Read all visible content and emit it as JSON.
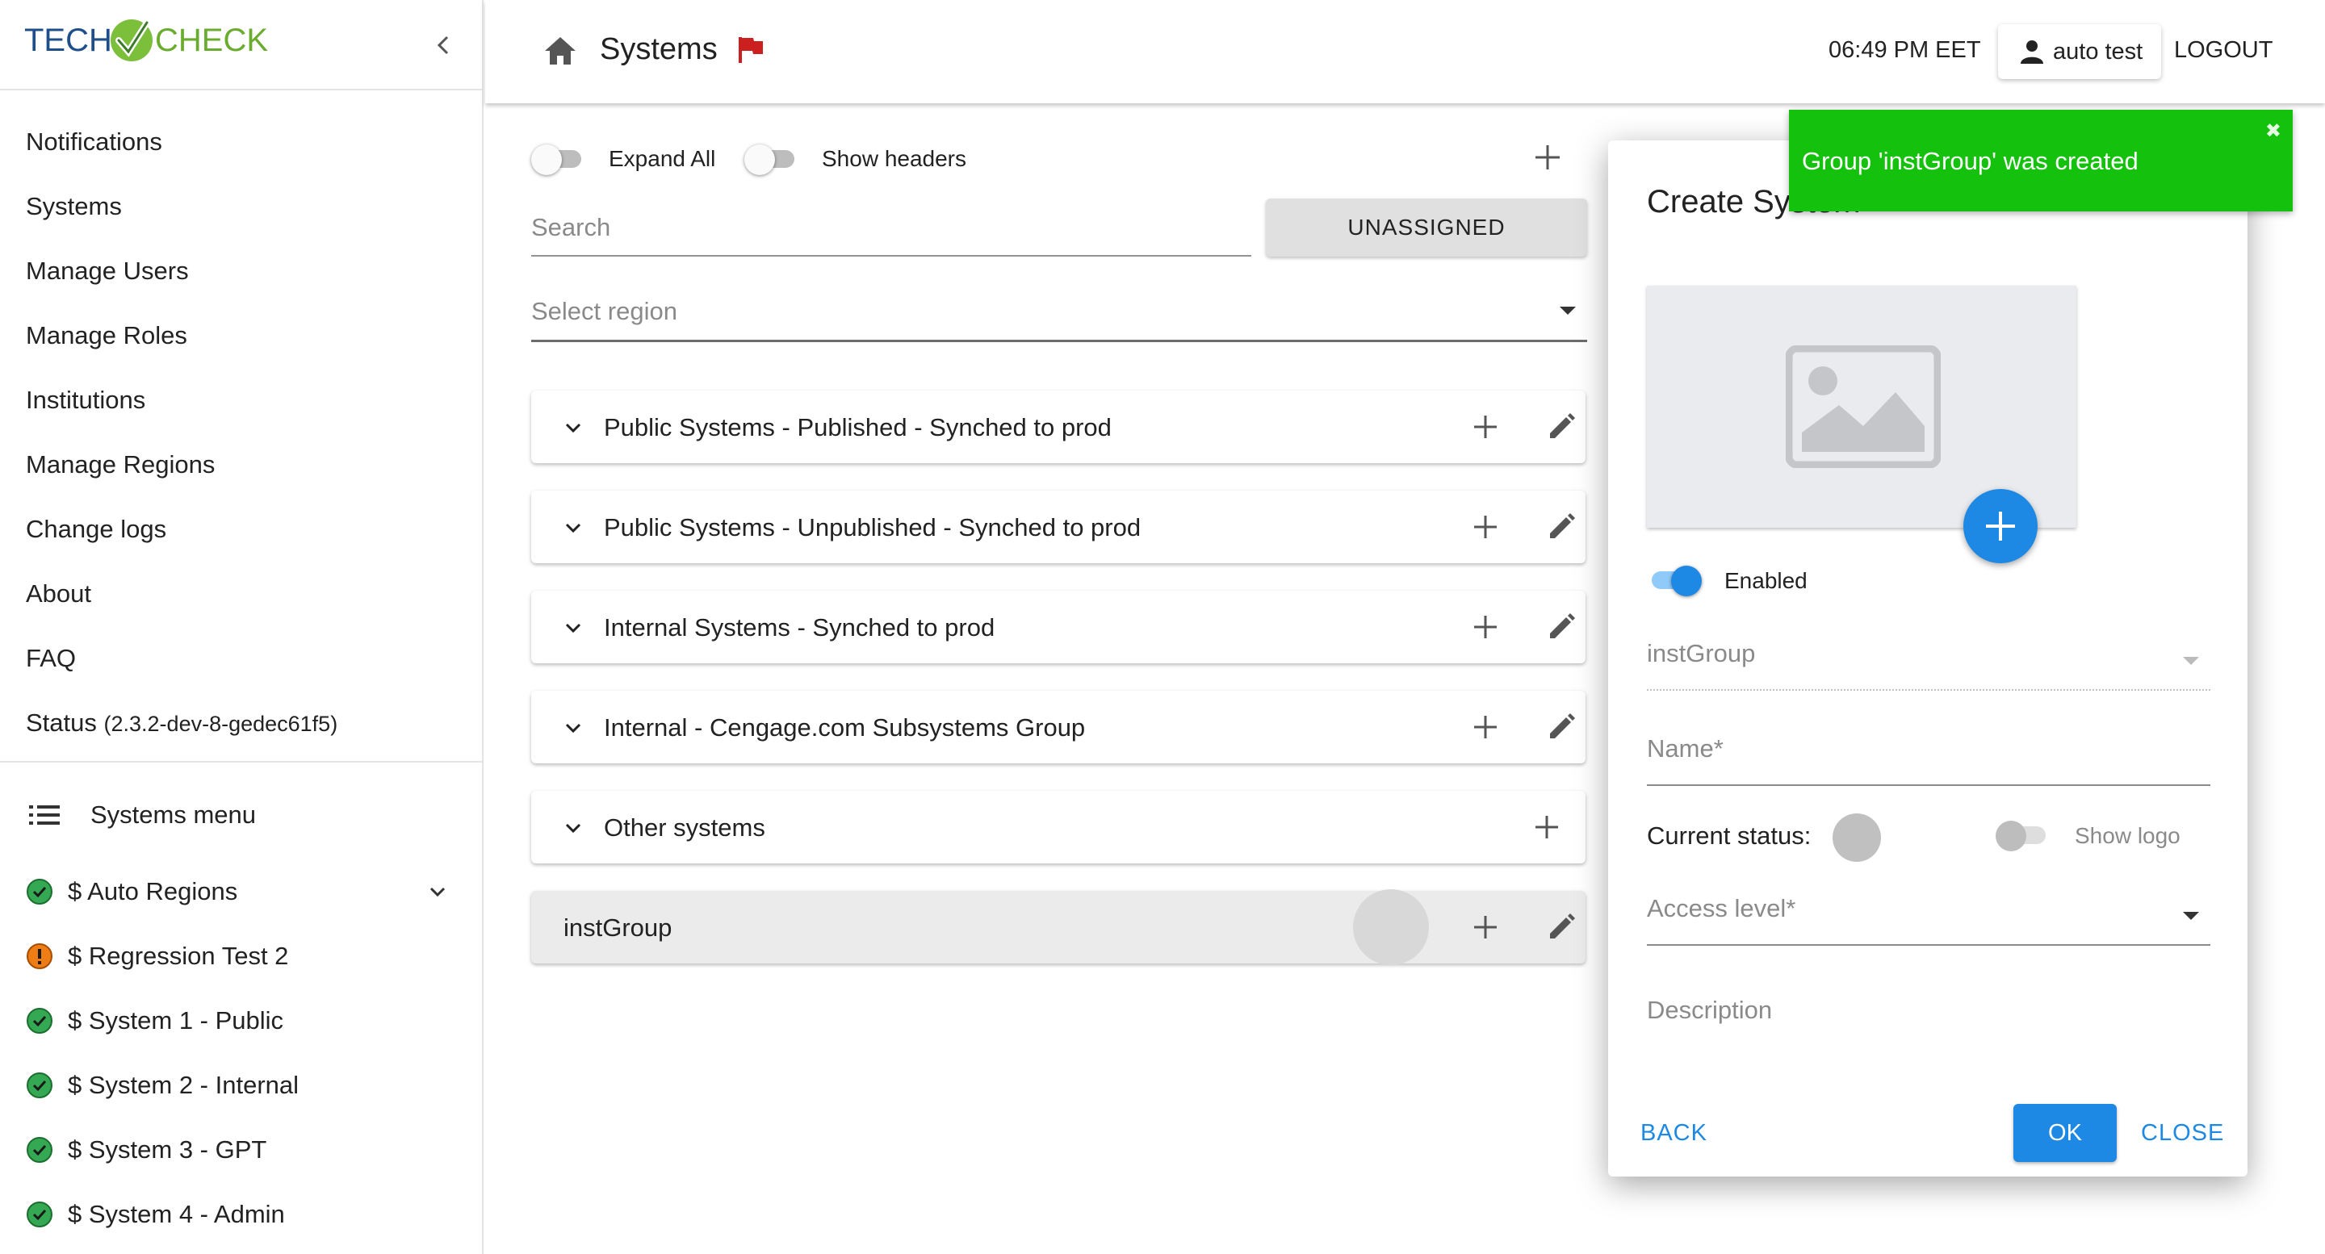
{
  "app": {
    "logo_text_left": "TECH",
    "logo_text_right": "CHECK"
  },
  "sidebar": {
    "nav": [
      {
        "label": "Notifications"
      },
      {
        "label": "Systems"
      },
      {
        "label": "Manage Users"
      },
      {
        "label": "Manage Roles"
      },
      {
        "label": "Institutions"
      },
      {
        "label": "Manage Regions"
      },
      {
        "label": "Change logs"
      },
      {
        "label": "About"
      },
      {
        "label": "FAQ"
      }
    ],
    "status_label": "Status",
    "status_version": "(2.3.2-dev-8-gedec61f5)",
    "systems_menu_label": "Systems menu",
    "systems": [
      {
        "label": "$ Auto Regions",
        "status": "ok"
      },
      {
        "label": "$ Regression Test 2",
        "status": "warning"
      },
      {
        "label": "$ System 1 - Public",
        "status": "ok"
      },
      {
        "label": "$ System 2 - Internal",
        "status": "ok"
      },
      {
        "label": "$ System 3 - GPT",
        "status": "ok"
      },
      {
        "label": "$ System 4 - Admin",
        "status": "ok"
      }
    ]
  },
  "header": {
    "title": "Systems",
    "time": "06:49 PM EET",
    "user": "auto test",
    "logout": "LOGOUT"
  },
  "toolbar": {
    "expand_all": "Expand All",
    "show_headers": "Show headers",
    "search_placeholder": "Search",
    "unassigned": "UNASSIGNED",
    "region_placeholder": "Select region"
  },
  "groups": [
    {
      "name": "Public Systems - Published - Synched to prod"
    },
    {
      "name": "Public Systems - Unpublished - Synched to prod"
    },
    {
      "name": "Internal Systems - Synched to prod"
    },
    {
      "name": "Internal - Cengage.com Subsystems Group"
    },
    {
      "name": "Other systems"
    },
    {
      "name": "instGroup"
    }
  ],
  "dialog": {
    "title": "Create System",
    "enabled_label": "Enabled",
    "group_value": "instGroup",
    "name_label": "Name*",
    "current_status_label": "Current status:",
    "show_logo_label": "Show logo",
    "access_level_label": "Access level*",
    "description_label": "Description",
    "back": "BACK",
    "ok": "OK",
    "close": "CLOSE"
  },
  "toast": {
    "message": "Group 'instGroup' was created",
    "close_glyph": "✖"
  },
  "colors": {
    "accent": "#1e88e5",
    "success": "#14c10c",
    "ok_status": "#34a853",
    "warning_status": "#ef7d15",
    "flag": "#cc1f1f"
  }
}
